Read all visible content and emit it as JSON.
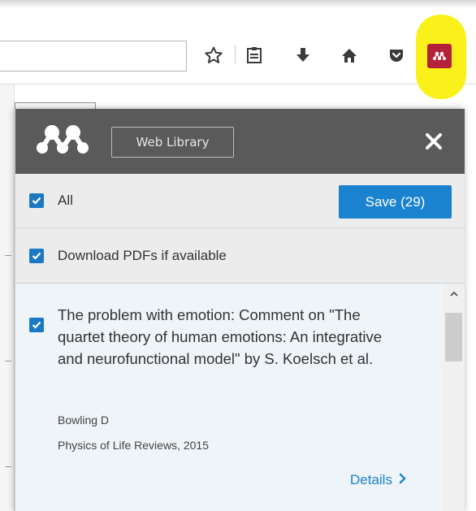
{
  "toolbar": {
    "icons": [
      "star-icon",
      "reader-list-icon",
      "download-icon",
      "home-icon",
      "pocket-icon",
      "mendeley-extension-icon"
    ]
  },
  "popup": {
    "web_library_label": "Web Library",
    "select_all_label": "All",
    "save_label": "Save (29)",
    "download_pdfs_label": "Download PDFs if available",
    "items": [
      {
        "title": "The problem with emotion: Comment on \"The quartet theory of human emotions: An integrative and neurofunctional model\" by S. Koelsch et al.",
        "author": "Bowling D",
        "journal": "Physics of Life Reviews, 2015",
        "details_label": "Details"
      }
    ]
  },
  "colors": {
    "accent": "#1a82cf",
    "header": "#5a5a5a",
    "highlight": "#fbf11a",
    "extension_red": "#b3213a"
  }
}
